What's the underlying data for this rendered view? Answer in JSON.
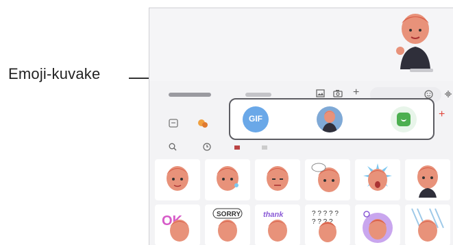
{
  "callout": {
    "label": "Emoji-kuvake"
  },
  "highlight": {
    "gif_label": "GIF",
    "items": [
      "gif-icon",
      "emoji-avatar-icon",
      "bitmoji-icon"
    ]
  },
  "toolbar": {
    "icons": [
      "image-icon",
      "camera-icon",
      "plus-icon",
      "emoji-face-icon",
      "voice-wave-icon"
    ]
  },
  "tabs": {
    "icons": [
      "sticker-tab-icon",
      "emoji-tab-icon"
    ]
  },
  "filters": {
    "icons": [
      "search-icon",
      "recent-clock-icon"
    ]
  },
  "colors": {
    "gif_blue": "#6aa8e8",
    "bitmoji_green": "#4caf50",
    "accent_red": "#e0463a"
  }
}
